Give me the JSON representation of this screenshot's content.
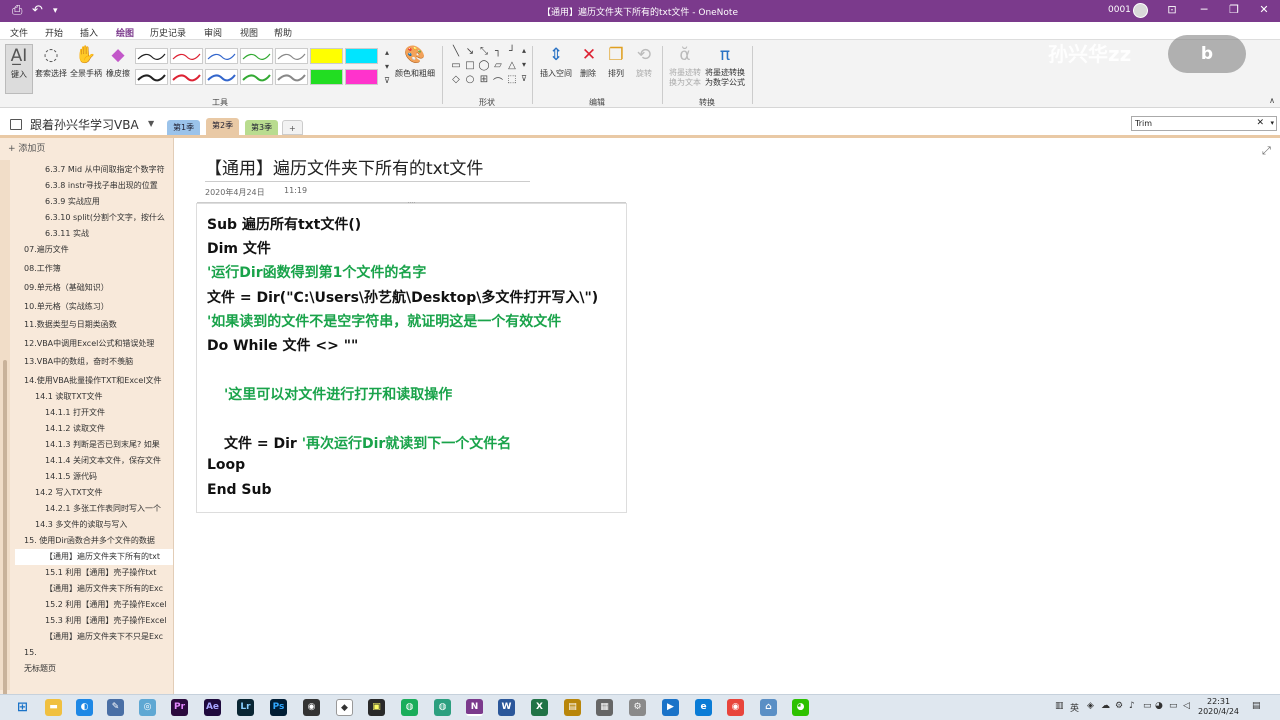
{
  "titlebar": {
    "title": "【通用】遍历文件夹下所有的txt文件  -  OneNote",
    "account": "0001",
    "minimize": "─",
    "restore": "❐",
    "close": "✕",
    "options": "⊡"
  },
  "menu": [
    "文件",
    "开始",
    "插入",
    "绘图",
    "历史记录",
    "审阅",
    "视图",
    "帮助"
  ],
  "ribbon": {
    "tools": {
      "type_label": "键入",
      "lasso_label": "套索选择",
      "pan_label": "全景手柄",
      "eraser_label": "橡皮擦",
      "color_label": "颜色和粗细",
      "group": "工具"
    },
    "shapes_group": "形状",
    "edit": {
      "insert_space": "插入空间",
      "delete": "删除",
      "arrange": "排列",
      "rotate": "旋转",
      "group": "编辑"
    },
    "convert": {
      "ink_to_text": "将墨迹转换为文本",
      "ink_to_math": "将墨迹转换为数学公式",
      "group": "转换"
    }
  },
  "notebook": {
    "name": "跟着孙兴华学习VBA",
    "sections": [
      "第1季",
      "第2季",
      "第3季"
    ],
    "add": "+"
  },
  "search": {
    "value": "Trim",
    "clear": "✕"
  },
  "sidebar": {
    "add_page": "+ 添加页",
    "pages": [
      "6.3.7 Mid 从中间取指定个数字符",
      "6.3.8 instr寻找子串出现的位置",
      "6.3.9 实战应用",
      "6.3.10 split(分割个文字，按什么",
      "6.3.11 实战",
      "07.遍历文件",
      "08.工作簿",
      "09.单元格（基础知识）",
      "10.单元格（实战练习）",
      "11.数据类型与日期类函数",
      "12.VBA中调用Excel公式和错误处理",
      "13.VBA中的数组，奋时不羡脑",
      "14.使用VBA批量操作TXT和Excel文件",
      "14.1 读取TXT文件",
      "14.1.1 打开文件",
      "14.1.2 读取文件",
      "14.1.3 判断是否已到末尾? 如果",
      "14.1.4 关闭文本文件，保存文件",
      "14.1.5 源代码",
      "14.2 写入TXT文件",
      "14.2.1 多张工作表同时写入一个",
      "14.3 多文件的读取与写入",
      "15. 使用Dir函数合并多个文件的数据",
      "【通用】遍历文件夹下所有的txt",
      "15.1 利用【通用】壳子操作txt",
      "【通用】遍历文件夹下所有的Exc",
      "15.2 利用【通用】壳子操作Excel",
      "15.3 利用【通用】壳子操作Excel",
      "【通用】遍历文件夹下不只是Exc",
      "15.",
      "无标题页"
    ]
  },
  "page": {
    "title": "【通用】遍历文件夹下所有的txt文件",
    "date": "2020年4月24日",
    "time": "11:19",
    "code": {
      "l1": "Sub 遍历所有txt文件()",
      "l2": "Dim 文件",
      "l3": "'运行Dir函数得到第1个文件的名字",
      "l4": "文件 = Dir(\"C:\\Users\\孙艺航\\Desktop\\多文件打开写入\\\")",
      "l5": "'如果读到的文件不是空字符串，就证明这是一个有效文件",
      "l6": "Do While 文件 <> \"\"",
      "l7": "'这里可以对文件进行打开和读取操作",
      "l8a": "文件 = Dir ",
      "l8b": "'再次运行Dir就读到下一个文件名",
      "l9": "Loop",
      "l10": "End Sub"
    }
  },
  "watermark": {
    "text": "孙兴华zz",
    "logo": "bili"
  },
  "taskbar": {
    "lang": "英",
    "time": "22:31",
    "date": "2020/4/24"
  },
  "colors": {
    "accent": "#7b3a8c",
    "comment": "#19a34a",
    "sidebar_bg": "#f8e9da"
  }
}
